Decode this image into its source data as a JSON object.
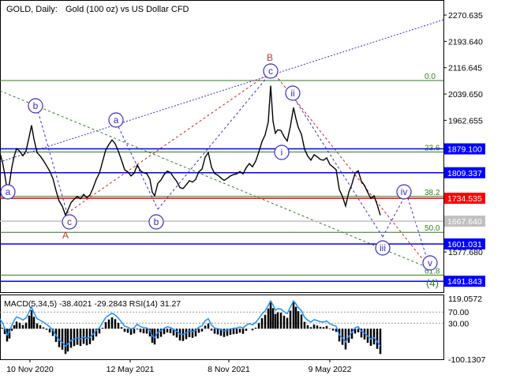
{
  "header": {
    "symbol": "GOLD, Daily:",
    "description": "Gold (100 oz) vs US Dollar CFD"
  },
  "chart_data": {
    "type": "line",
    "price_ylim": [
      1460,
      2310
    ],
    "price_ticks": [
      2270.635,
      2193.64,
      2116.645,
      2039.65,
      1962.655,
      1577.68
    ],
    "level_boxes": [
      {
        "value": 1879.1,
        "label": "1879.100",
        "color": "#0000ff",
        "fill": "#0000ff"
      },
      {
        "value": 1809.337,
        "label": "1809.337",
        "color": "#0000ff",
        "fill": "#0000ff"
      },
      {
        "value": 1734.535,
        "label": "1734.535",
        "color": "#ff0000",
        "fill": "#ff0000"
      },
      {
        "value": 1667.64,
        "label": "1667.640",
        "color": "#c0c0c0",
        "fill": "#c0c0c0"
      },
      {
        "value": 1601.031,
        "label": "1601.031",
        "color": "#0000ff",
        "fill": "#0000ff"
      },
      {
        "value": 1491.843,
        "label": "1491.843",
        "color": "#0000ff",
        "fill": "#0000ff"
      }
    ],
    "fib_levels": [
      {
        "value": 2079,
        "label": "0.0"
      },
      {
        "value": 1870,
        "label": "23.6"
      },
      {
        "value": 1740,
        "label": "38.2"
      },
      {
        "value": 1635,
        "label": "50.0"
      },
      {
        "value": 1510,
        "label": "61.8"
      }
    ],
    "x_ticks": [
      "10 Nov 2020",
      "12 May 2021",
      "8 Nov 2021",
      "9 May 2022"
    ],
    "price_series": [
      [
        0,
        1866
      ],
      [
        3,
        1842
      ],
      [
        6,
        1805
      ],
      [
        9,
        1760
      ],
      [
        12,
        1778
      ],
      [
        15,
        1825
      ],
      [
        18,
        1858
      ],
      [
        21,
        1880
      ],
      [
        25,
        1872
      ],
      [
        29,
        1859
      ],
      [
        33,
        1873
      ],
      [
        37,
        1915
      ],
      [
        40,
        1948
      ],
      [
        43,
        1908
      ],
      [
        47,
        1868
      ],
      [
        51,
        1858
      ],
      [
        55,
        1845
      ],
      [
        59,
        1830
      ],
      [
        63,
        1814
      ],
      [
        67,
        1793
      ],
      [
        71,
        1757
      ],
      [
        75,
        1726
      ],
      [
        79,
        1711
      ],
      [
        83,
        1685
      ],
      [
        86,
        1700
      ],
      [
        90,
        1722
      ],
      [
        94,
        1732
      ],
      [
        98,
        1740
      ],
      [
        102,
        1733
      ],
      [
        106,
        1746
      ],
      [
        110,
        1737
      ],
      [
        114,
        1744
      ],
      [
        118,
        1765
      ],
      [
        122,
        1790
      ],
      [
        126,
        1808
      ],
      [
        130,
        1842
      ],
      [
        134,
        1876
      ],
      [
        138,
        1892
      ],
      [
        142,
        1905
      ],
      [
        146,
        1894
      ],
      [
        150,
        1872
      ],
      [
        154,
        1846
      ],
      [
        158,
        1818
      ],
      [
        162,
        1812
      ],
      [
        166,
        1800
      ],
      [
        170,
        1808
      ],
      [
        174,
        1832
      ],
      [
        178,
        1815
      ],
      [
        182,
        1809
      ],
      [
        186,
        1807
      ],
      [
        190,
        1790
      ],
      [
        193,
        1752
      ],
      [
        196,
        1742
      ],
      [
        200,
        1778
      ],
      [
        204,
        1788
      ],
      [
        208,
        1804
      ],
      [
        212,
        1814
      ],
      [
        216,
        1810
      ],
      [
        220,
        1796
      ],
      [
        224,
        1784
      ],
      [
        228,
        1766
      ],
      [
        232,
        1763
      ],
      [
        236,
        1774
      ],
      [
        240,
        1786
      ],
      [
        244,
        1782
      ],
      [
        248,
        1790
      ],
      [
        252,
        1812
      ],
      [
        256,
        1820
      ],
      [
        260,
        1855
      ],
      [
        264,
        1868
      ],
      [
        268,
        1826
      ],
      [
        272,
        1807
      ],
      [
        276,
        1802
      ],
      [
        280,
        1794
      ],
      [
        284,
        1787
      ],
      [
        288,
        1793
      ],
      [
        292,
        1800
      ],
      [
        296,
        1804
      ],
      [
        300,
        1806
      ],
      [
        304,
        1813
      ],
      [
        308,
        1806
      ],
      [
        312,
        1824
      ],
      [
        316,
        1836
      ],
      [
        320,
        1827
      ],
      [
        324,
        1843
      ],
      [
        328,
        1870
      ],
      [
        332,
        1900
      ],
      [
        336,
        1920
      ],
      [
        340,
        1958
      ],
      [
        343,
        2064
      ],
      [
        346,
        1960
      ],
      [
        349,
        1925
      ],
      [
        352,
        1935
      ],
      [
        356,
        1933
      ],
      [
        360,
        1915
      ],
      [
        364,
        1902
      ],
      [
        368,
        1945
      ],
      [
        372,
        2000
      ],
      [
        375,
        1968
      ],
      [
        378,
        1942
      ],
      [
        382,
        1922
      ],
      [
        386,
        1878
      ],
      [
        390,
        1858
      ],
      [
        394,
        1846
      ],
      [
        398,
        1862
      ],
      [
        402,
        1856
      ],
      [
        406,
        1848
      ],
      [
        410,
        1846
      ],
      [
        414,
        1853
      ],
      [
        418,
        1834
      ],
      [
        422,
        1826
      ],
      [
        426,
        1818
      ],
      [
        430,
        1760
      ],
      [
        434,
        1740
      ],
      [
        438,
        1712
      ],
      [
        442,
        1752
      ],
      [
        446,
        1776
      ],
      [
        450,
        1808
      ],
      [
        454,
        1815
      ],
      [
        458,
        1784
      ],
      [
        462,
        1772
      ],
      [
        466,
        1752
      ],
      [
        470,
        1734
      ],
      [
        474,
        1742
      ],
      [
        478,
        1716
      ],
      [
        482,
        1685
      ]
    ],
    "elliptical_trends": []
  },
  "waves": {
    "a_low": "a",
    "b1": "b",
    "c1": "c",
    "a2": "a",
    "b2": "b",
    "A": "A",
    "B": "B",
    "c_top": "c",
    "i": "i",
    "ii": "ii",
    "iii": "iii",
    "iv": "iv",
    "v": "v",
    "four": "(4)"
  },
  "indicator": {
    "label": "MACD(5,34,5) -38.4021 -29.2843 RSI(14) 31.27",
    "ticks": [
      "119.0572",
      "70.00",
      "30.00",
      "-100.1307"
    ]
  }
}
